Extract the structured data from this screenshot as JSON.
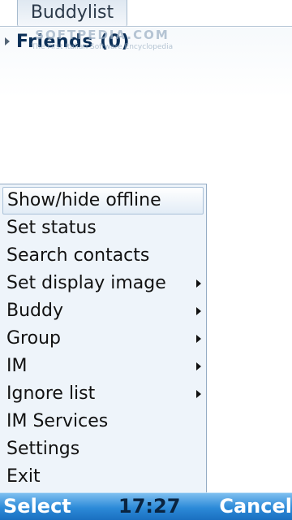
{
  "tab": {
    "label": "Buddylist"
  },
  "tree": {
    "group_label": "Friends (0)"
  },
  "watermark": {
    "logo": "SOFTPEDIA.COM",
    "tagline": "The First Italian Software Encyclopedia"
  },
  "menu": {
    "items": [
      {
        "label": "Show/hide offline",
        "submenu": false,
        "highlighted": true
      },
      {
        "label": "Set status",
        "submenu": false
      },
      {
        "label": "Search contacts",
        "submenu": false
      },
      {
        "label": "Set display image",
        "submenu": true
      },
      {
        "label": "Buddy",
        "submenu": true
      },
      {
        "label": "Group",
        "submenu": true
      },
      {
        "label": "IM",
        "submenu": true
      },
      {
        "label": "Ignore list",
        "submenu": true
      },
      {
        "label": "IM Services",
        "submenu": false
      },
      {
        "label": "Settings",
        "submenu": false
      },
      {
        "label": "Exit",
        "submenu": false
      }
    ]
  },
  "softkeys": {
    "left": "Select",
    "clock": "17:27",
    "right": "Cancel"
  },
  "colors": {
    "softkey_bar": "#2c8ad8",
    "menu_background": "#eef4fa",
    "group_label": "#0b2f57"
  }
}
